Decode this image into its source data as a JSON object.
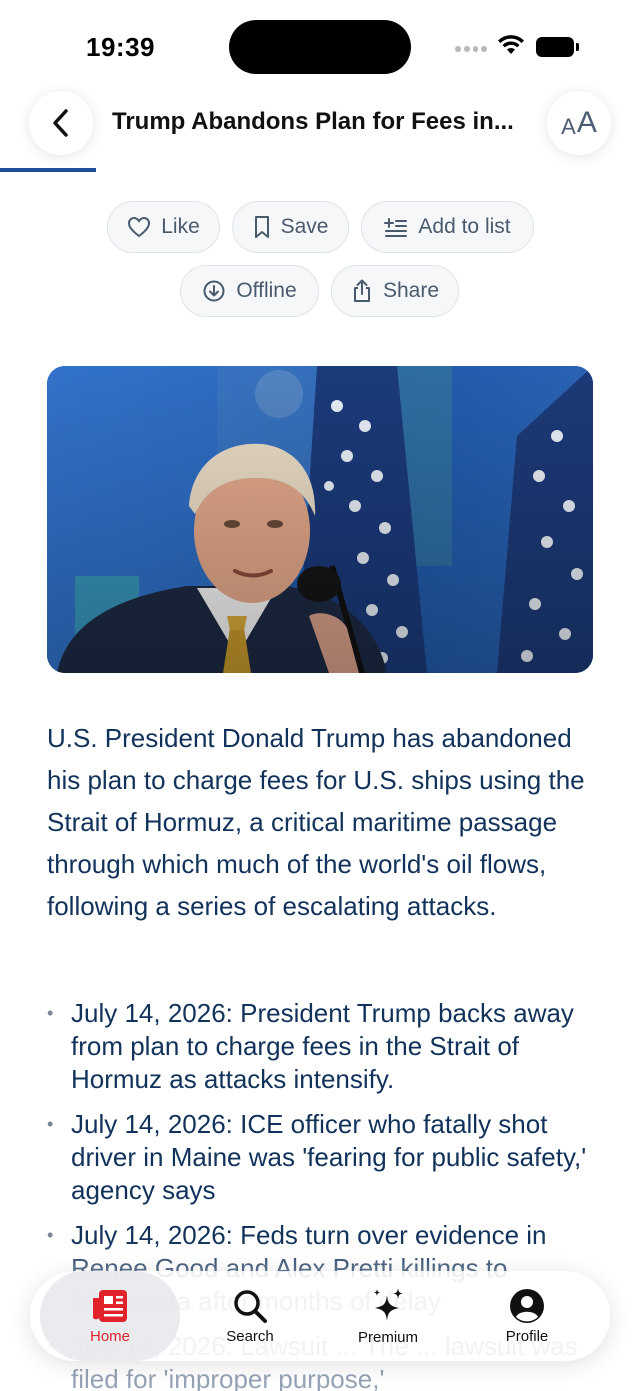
{
  "status_bar": {
    "time": "19:39"
  },
  "header": {
    "title": "Trump Abandons Plan for Fees in...",
    "font_button": {
      "small": "A",
      "big": "A"
    },
    "reading_progress": 0.15,
    "accent_color": "#1e4f9a"
  },
  "actions": {
    "like": "Like",
    "save": "Save",
    "add_to_list": "Add to list",
    "offline": "Offline",
    "share": "Share"
  },
  "article": {
    "lead": "U.S. President Donald Trump has abandoned his plan to charge fees for U.S. ships using the Strait of Hormuz, a critical maritime passage through which much of the world's oil flows, following a series of escalating attacks.",
    "bullets": [
      "July 14, 2026: President Trump backs away from plan to charge fees in the Strait of Hormuz as attacks intensify.",
      "July 14, 2026: ICE officer who fatally shot driver in Maine was 'fearing for public safety,' agency says",
      "July 14, 2026: Feds turn over evidence in Renee Good and Alex Pretti killings to Minnesota after months of delay",
      "July 14, 2026: Lawsuit ... The ... lawsuit was filed for 'improper purpose,'"
    ]
  },
  "tabbar": {
    "items": [
      {
        "label": "Home",
        "icon": "newspaper-icon",
        "active": true
      },
      {
        "label": "Search",
        "icon": "search-icon",
        "active": false
      },
      {
        "label": "Premium",
        "icon": "sparkles-icon",
        "active": false
      },
      {
        "label": "Profile",
        "icon": "person-circle-icon",
        "active": false
      }
    ],
    "active_color": "#e0222a"
  }
}
